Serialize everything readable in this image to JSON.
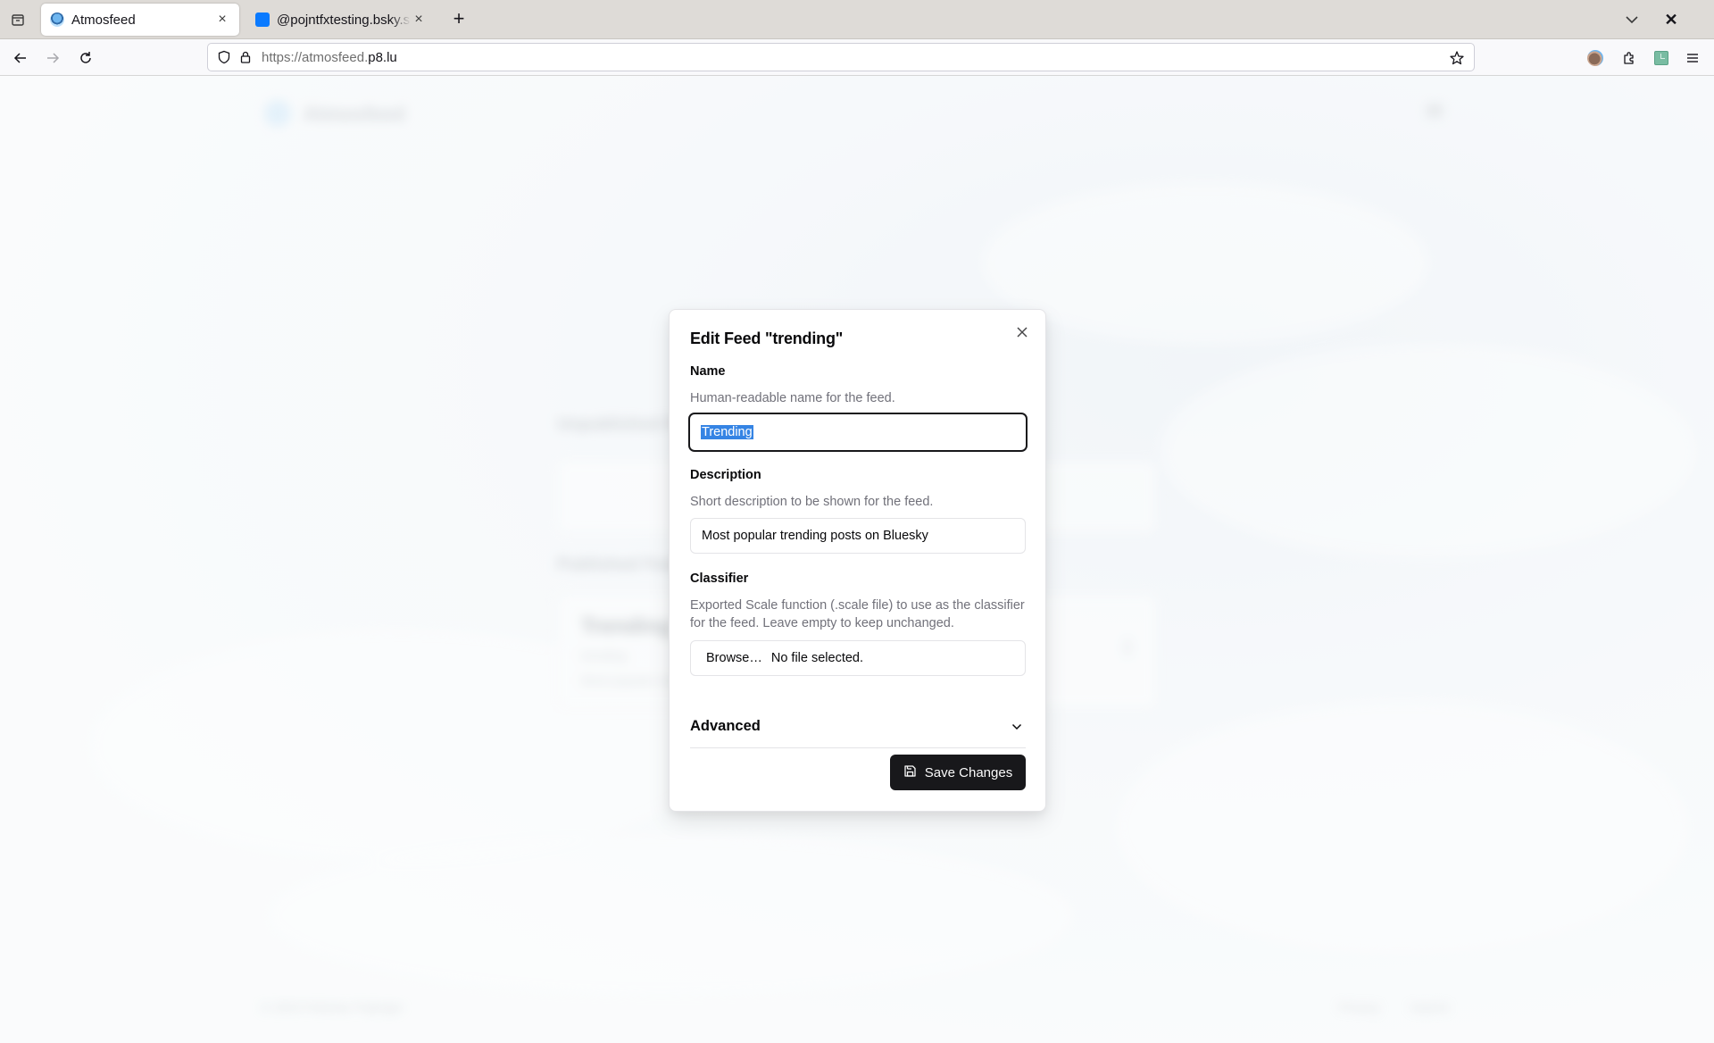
{
  "browser": {
    "tabs": [
      {
        "title": "Atmosfeed",
        "active": true,
        "favicon": "atmosfeed-logo"
      },
      {
        "title": "@pojntfxtesting.bsky.social",
        "active": false,
        "favicon": "bluesky-square"
      }
    ],
    "url_prefix": "https://atmosfeed.",
    "url_domain": "p8.lu",
    "icons": {
      "tab_list": "tab-list-icon",
      "new_tab": "+",
      "back": "arrow-left-icon",
      "forward": "arrow-right-icon",
      "reload": "reload-icon",
      "shield": "shield-icon",
      "lock": "lock-icon",
      "bookmark": "star-icon",
      "account": "account-avatar-icon",
      "extensions": "puzzle-icon",
      "sidebar_ext": "extension-icon",
      "menu": "hamburger-icon"
    }
  },
  "background": {
    "brand": "Atmosfeed",
    "sections": [
      "Unpublished Feeds",
      "Published Feeds"
    ],
    "published_card": {
      "title": "Trending",
      "subtitle": "trending",
      "description": "Most popular trending posts on Bluesky"
    },
    "footer": {
      "copyright": "© 2023 Felicitas Pojtinger",
      "links": [
        "Privacy",
        "Imprint"
      ]
    }
  },
  "modal": {
    "title": "Edit Feed \"trending\"",
    "name": {
      "label": "Name",
      "help": "Human-readable name for the feed.",
      "value": "Trending"
    },
    "description": {
      "label": "Description",
      "help": "Short description to be shown for the feed.",
      "value": "Most popular trending posts on Bluesky"
    },
    "classifier": {
      "label": "Classifier",
      "help": "Exported Scale function (.scale file) to use as the classifier for the feed. Leave empty to keep unchanged.",
      "browse_label": "Browse…",
      "file_status": "No file selected."
    },
    "advanced_label": "Advanced",
    "save_label": "Save Changes"
  }
}
